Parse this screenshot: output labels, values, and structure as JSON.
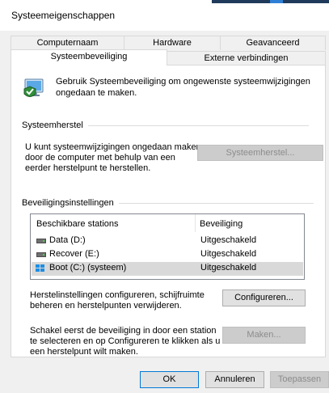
{
  "window": {
    "title": "Systeemeigenschappen"
  },
  "tabs": {
    "row1": [
      {
        "label": "Computernaam"
      },
      {
        "label": "Hardware"
      },
      {
        "label": "Geavanceerd"
      }
    ],
    "row2": [
      {
        "label": "Systeembeveiliging"
      },
      {
        "label": "Externe verbindingen"
      }
    ]
  },
  "intro": {
    "text_line1": "Gebruik Systeembeveiliging om ongewenste systeemwijzigingen",
    "text_line2": "ongedaan te maken.",
    "icon": "system-protection-icon"
  },
  "restore": {
    "group_title": "Systeemherstel",
    "desc_line1": "U kunt systeemwijzigingen ongedaan maken",
    "desc_line2": "door de computer met behulp van een",
    "desc_line3": "eerder herstelpunt te herstellen.",
    "button_label": "Systeemherstel..."
  },
  "protection": {
    "group_title": "Beveiligingsinstellingen",
    "columns": [
      "Beschikbare stations",
      "Beveiliging"
    ],
    "drives": [
      {
        "name": "Data (D:)",
        "status": "Uitgeschakeld",
        "icon": "drive-icon"
      },
      {
        "name": "Recover (E:)",
        "status": "Uitgeschakeld",
        "icon": "drive-icon"
      },
      {
        "name": "Boot (C:) (systeem)",
        "status": "Uitgeschakeld",
        "icon": "windows-drive-icon"
      }
    ],
    "configure_line1": "Herstelinstellingen configureren, schijfruimte",
    "configure_line2": "beheren en herstelpunten verwijderen.",
    "configure_button": "Configureren...",
    "create_line1": "Schakel eerst de beveiliging in door een station",
    "create_line2": "te selecteren en op Configureren te klikken als u",
    "create_line3": "een herstelpunt wilt maken.",
    "create_button": "Maken..."
  },
  "footer": {
    "ok": "OK",
    "cancel": "Annuleren",
    "apply": "Toepassen"
  }
}
